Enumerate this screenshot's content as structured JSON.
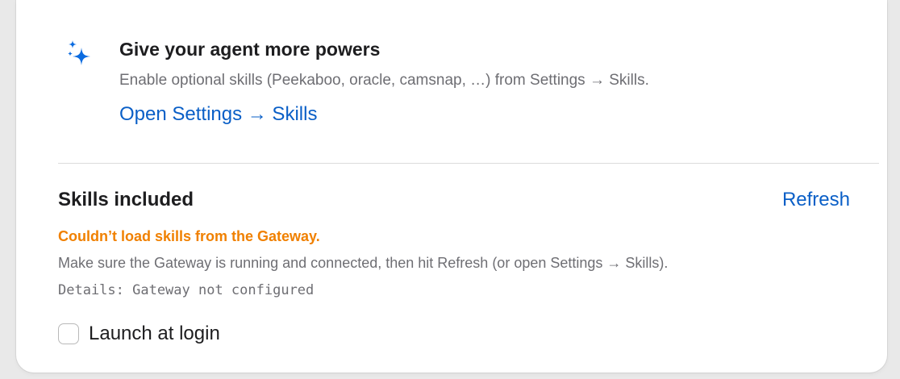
{
  "promo": {
    "icon": "sparkles-icon",
    "title": "Give your agent more powers",
    "subtitle": "Enable optional skills (Peekaboo, oracle, camsnap, …) from Settings → Skills.",
    "link_label": "Open Settings → Skills",
    "accent_color": "#0a5fc7"
  },
  "skills": {
    "title": "Skills included",
    "refresh_label": "Refresh",
    "error_text": "Couldn’t load skills from the Gateway.",
    "error_color": "#f08000",
    "help_text": "Make sure the Gateway is running and connected, then hit Refresh (or open Settings → Skills).",
    "details_text": "Details: Gateway not configured"
  },
  "launch_at_login": {
    "label": "Launch at login",
    "checked": false
  }
}
